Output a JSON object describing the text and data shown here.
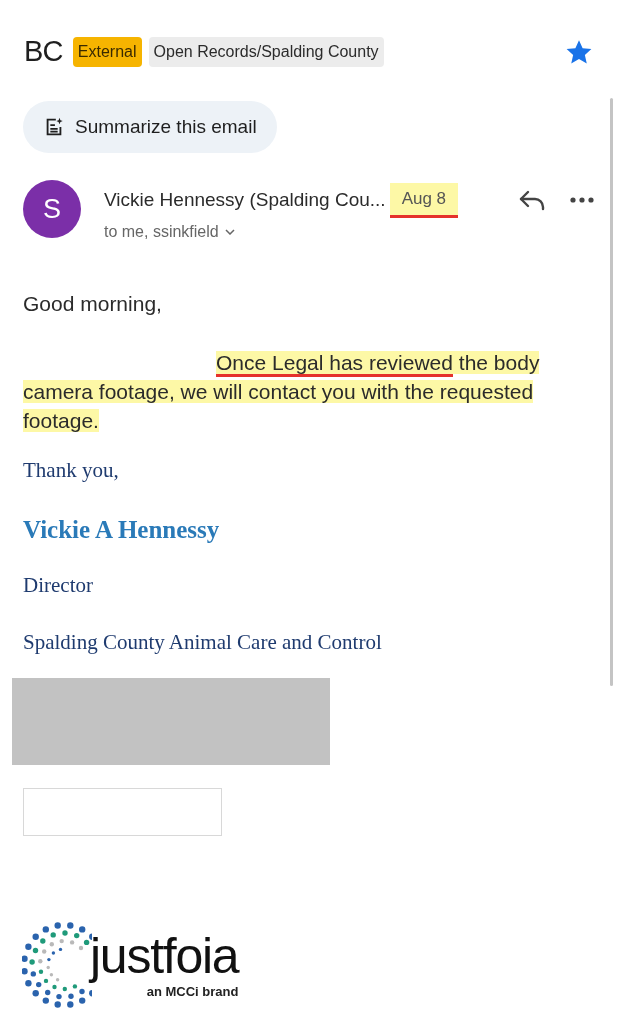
{
  "header": {
    "subject": "BC",
    "labels": [
      {
        "text": "External",
        "kind": "warning"
      },
      {
        "text": "Open Records/Spalding County",
        "kind": "folder"
      }
    ],
    "starred": true
  },
  "summarize_button": "Summarize this email",
  "message": {
    "avatar_letter": "S",
    "sender": "Vickie Hennessy (Spalding Cou...",
    "date": {
      "text": "Aug 8",
      "highlighted": true,
      "underlined": true
    },
    "recipients": "to me, ssinkfield"
  },
  "body": {
    "greeting": "Good morning,",
    "paragraph": {
      "highlighted": true,
      "segments": [
        {
          "text": "Once Legal has reviewed",
          "underlined": true
        },
        {
          "text": " the body camera footage, we will contact you with the requested footage.",
          "underlined": false
        }
      ]
    }
  },
  "signature": {
    "closing": "Thank you,",
    "name": "Vickie A Hennessy",
    "title": "Director",
    "organization": "Spalding County Animal Care and Control"
  },
  "logo": {
    "wordmark": "justfoia",
    "tagline": "an MCCi brand"
  }
}
